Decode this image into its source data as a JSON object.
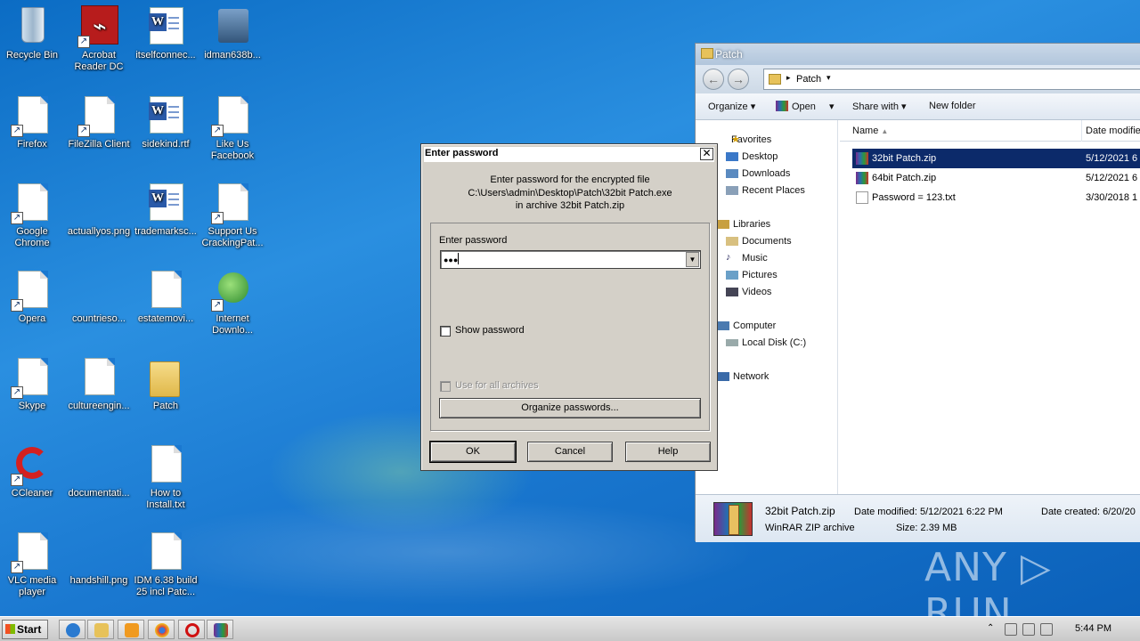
{
  "desktop": {
    "icons": [
      {
        "label": "Recycle Bin"
      },
      {
        "label": "Acrobat Reader DC"
      },
      {
        "label": "itselfconnec..."
      },
      {
        "label": "idman638b..."
      },
      {
        "label": "Firefox"
      },
      {
        "label": "FileZilla Client"
      },
      {
        "label": "sidekind.rtf"
      },
      {
        "label": "Like Us Facebook"
      },
      {
        "label": "Google Chrome"
      },
      {
        "label": "actuallyos.png"
      },
      {
        "label": "trademarksc..."
      },
      {
        "label": "Support Us CrackingPat..."
      },
      {
        "label": "Opera"
      },
      {
        "label": "countrieso..."
      },
      {
        "label": "estatemovi..."
      },
      {
        "label": "Internet Downlo..."
      },
      {
        "label": "Skype"
      },
      {
        "label": "cultureengin..."
      },
      {
        "label": "Patch"
      },
      {
        "label": "CCleaner"
      },
      {
        "label": "documentati..."
      },
      {
        "label": "How to Install.txt"
      },
      {
        "label": "VLC media player"
      },
      {
        "label": "handshill.png"
      },
      {
        "label": "IDM 6.38 build 25 incl Patc..."
      }
    ]
  },
  "explorer": {
    "title": "Patch",
    "address": "Patch",
    "toolbar": {
      "organize": "Organize",
      "open": "Open",
      "share_with": "Share with",
      "new_folder": "New folder"
    },
    "nav": {
      "favorites": "Favorites",
      "desktop": "Desktop",
      "downloads": "Downloads",
      "recent": "Recent Places",
      "libraries": "Libraries",
      "documents": "Documents",
      "music": "Music",
      "pictures": "Pictures",
      "videos": "Videos",
      "computer": "Computer",
      "local_disk": "Local Disk (C:)",
      "network": "Network"
    },
    "columns": {
      "name": "Name",
      "date_modified": "Date modifie"
    },
    "files": [
      {
        "name": "32bit Patch.zip",
        "date": "5/12/2021 6"
      },
      {
        "name": "64bit Patch.zip",
        "date": "5/12/2021 6"
      },
      {
        "name": "Password = 123.txt",
        "date": "3/30/2018 1"
      }
    ],
    "details": {
      "name": "32bit Patch.zip",
      "type": "WinRAR ZIP archive",
      "date_modified_label": "Date modified:",
      "date_modified": "5/12/2021 6:22 PM",
      "size_label": "Size:",
      "size": "2.39 MB",
      "date_created_label": "Date created:",
      "date_created": "6/20/20"
    }
  },
  "dialog": {
    "title": "Enter password",
    "close": "✕",
    "info_line1": "Enter password for the encrypted file",
    "info_line2": "C:\\Users\\admin\\Desktop\\Patch\\32bit Patch.exe",
    "info_line3": "in archive 32bit Patch.zip",
    "password_label": "Enter password",
    "password_value": "●●●",
    "show_password": "Show password",
    "use_for_all": "Use for all archives",
    "organize_passwords": "Organize passwords...",
    "ok": "OK",
    "cancel": "Cancel",
    "help": "Help"
  },
  "taskbar": {
    "start": "Start",
    "clock": "5:44 PM"
  },
  "watermark": "ANY ▷ RUN"
}
